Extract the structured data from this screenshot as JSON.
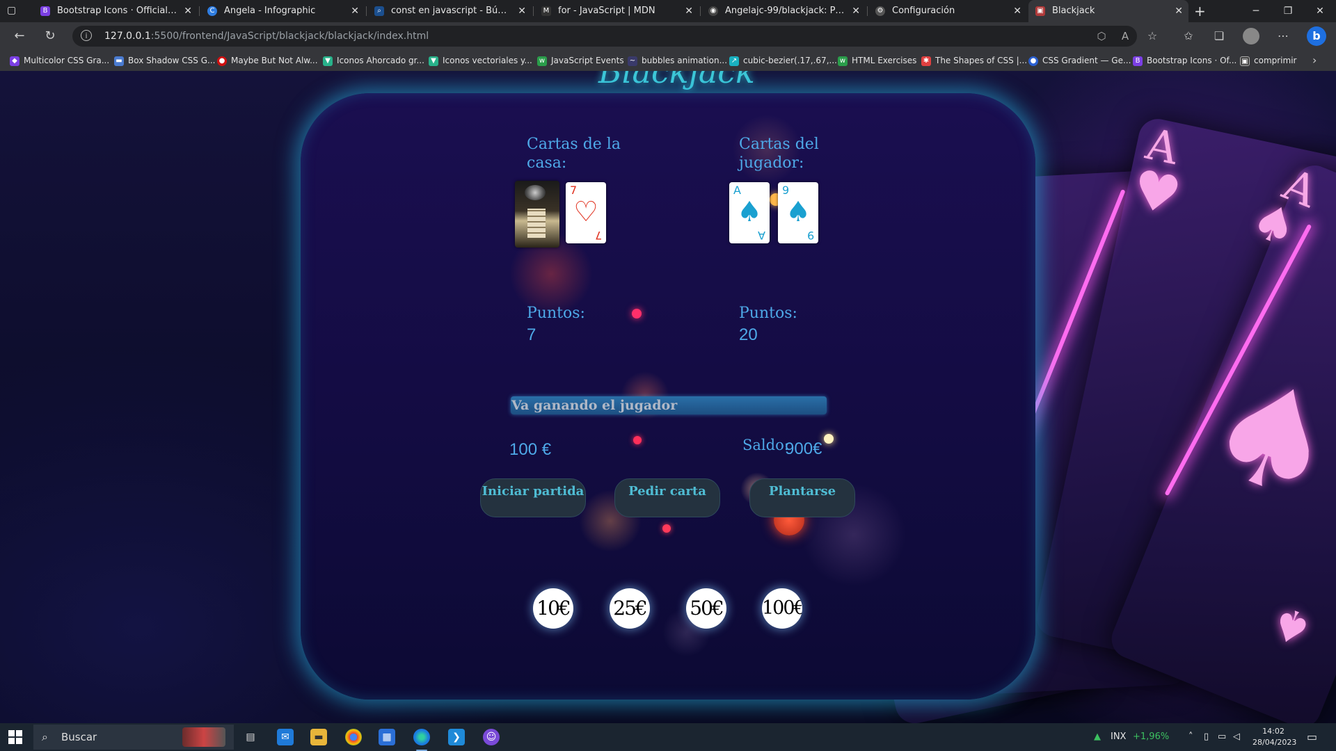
{
  "browser": {
    "tabs": [
      {
        "title": "Bootstrap Icons · Official open sc",
        "favicon": "B",
        "favicon_color": "#7b3fe4",
        "active": false
      },
      {
        "title": "Angela - Infographic",
        "favicon": "C",
        "favicon_color": "#2f7de1",
        "active": false
      },
      {
        "title": "const en javascript - Búsqueda",
        "favicon": "⌕",
        "favicon_color": "#1b4f8f",
        "active": false
      },
      {
        "title": "for - JavaScript | MDN",
        "favicon": "M",
        "favicon_color": "#333333",
        "active": false
      },
      {
        "title": "Angelajc-99/blackjack: Proyecto",
        "favicon": "◉",
        "favicon_color": "#444444",
        "active": false
      },
      {
        "title": "Configuración",
        "favicon": "⚙",
        "favicon_color": "#555555",
        "active": false
      },
      {
        "title": "Blackjack",
        "favicon": "▣",
        "favicon_color": "#b03a3a",
        "active": true
      }
    ],
    "url_host": "127.0.0.1",
    "url_path": ":5500/frontend/JavaScript/blackjack/blackjack/index.html",
    "bookmarks": [
      {
        "label": "Multicolor CSS Gra...",
        "icon": "◆",
        "color": "#7b3fe4"
      },
      {
        "label": "Box Shadow CSS G...",
        "icon": "▬",
        "color": "#4a7bd0"
      },
      {
        "label": "Maybe But Not Alw...",
        "icon": "●",
        "color": "#d01010"
      },
      {
        "label": "Iconos Ahorcado gr...",
        "icon": "▼",
        "color": "#28b28a"
      },
      {
        "label": "Iconos vectoriales y...",
        "icon": "▼",
        "color": "#28b28a"
      },
      {
        "label": "JavaScript Events",
        "icon": "w",
        "color": "#2a9d4a"
      },
      {
        "label": "bubbles animation...",
        "icon": "~",
        "color": "#3a3a6a"
      },
      {
        "label": "cubic-bezier(.17,.67,...",
        "icon": "↗",
        "color": "#1ab0c0"
      },
      {
        "label": "HTML Exercises",
        "icon": "w",
        "color": "#2a9d4a"
      },
      {
        "label": "The Shapes of CSS |...",
        "icon": "✱",
        "color": "#e04040"
      },
      {
        "label": "CSS Gradient — Ge...",
        "icon": "●",
        "color": "#2a5fd0"
      },
      {
        "label": "Bootstrap Icons · Of...",
        "icon": "B",
        "color": "#7b3fe4"
      },
      {
        "label": "comprimir",
        "icon": "▣",
        "color": "#444444"
      }
    ]
  },
  "game": {
    "house_title": "Cartas de la casa:",
    "player_title": "Cartas del jugador:",
    "house_cards": [
      {
        "type": "back"
      },
      {
        "rank": "7",
        "suit": "♡",
        "color": "#e0301e"
      }
    ],
    "player_cards": [
      {
        "rank": "A",
        "suit": "♠",
        "color": "#1aa0d0"
      },
      {
        "rank": "9",
        "suit": "♠",
        "color": "#1aa0d0"
      }
    ],
    "points_label": "Puntos:",
    "house_points": "7",
    "player_points": "20",
    "status": "Va ganando el jugador",
    "bet": "100 €",
    "saldo_label": "Saldo:",
    "saldo_value": "900€",
    "buttons": {
      "start": "Iniciar partida",
      "hit": "Pedir carta",
      "stand": "Plantarse"
    },
    "chips": [
      "10€",
      "25€",
      "50€",
      "100€"
    ],
    "logo": "Blackjack"
  },
  "taskbar": {
    "search_placeholder": "Buscar",
    "stock_name": "INX",
    "stock_change": "+1,96%",
    "time": "14:02",
    "date": "28/04/2023"
  },
  "colors": {
    "accent_text": "#4ea9e8",
    "panel_glow": "#28b4e6",
    "button_text": "#4fbcd3",
    "button_bg": "#24323f"
  }
}
